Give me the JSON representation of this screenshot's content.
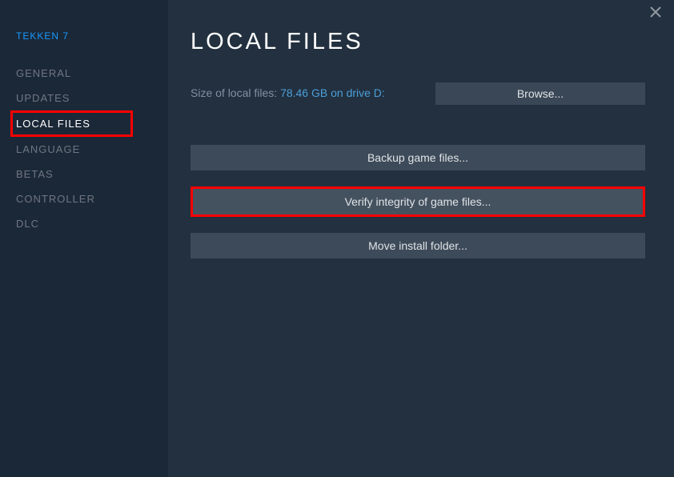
{
  "game_title": "TEKKEN 7",
  "sidebar": {
    "items": [
      {
        "label": "GENERAL",
        "active": false
      },
      {
        "label": "UPDATES",
        "active": false
      },
      {
        "label": "LOCAL FILES",
        "active": true
      },
      {
        "label": "LANGUAGE",
        "active": false
      },
      {
        "label": "BETAS",
        "active": false
      },
      {
        "label": "CONTROLLER",
        "active": false
      },
      {
        "label": "DLC",
        "active": false
      }
    ]
  },
  "main": {
    "title": "LOCAL FILES",
    "size_label": "Size of local files: ",
    "size_value": "78.46 GB on drive D:",
    "browse_label": "Browse...",
    "backup_label": "Backup game files...",
    "verify_label": "Verify integrity of game files...",
    "move_label": "Move install folder..."
  }
}
